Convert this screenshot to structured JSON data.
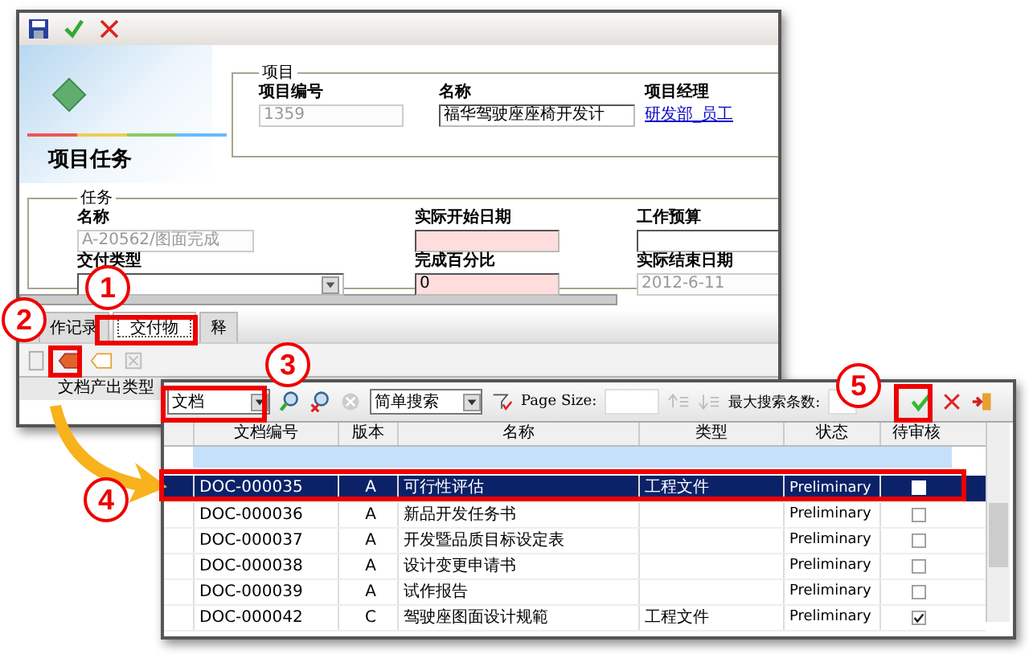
{
  "back_window": {
    "title": "项目任务",
    "project": {
      "legend": "项目",
      "fields": [
        {
          "label": "项目编号",
          "kind": "text",
          "value": "1359",
          "disabled": true
        },
        {
          "label": "名称",
          "kind": "text",
          "value": "福华驾驶座座椅开发计",
          "disabled": false
        },
        {
          "label": "项目经理",
          "kind": "link",
          "value": "研发部_员工"
        }
      ]
    },
    "task": {
      "legend": "任务",
      "fields": [
        {
          "label": "名称",
          "kind": "text",
          "value": "A-20562/图面完成",
          "disabled": true,
          "required": false
        },
        {
          "label": "实际开始日期",
          "kind": "text",
          "disabled": false,
          "required": true
        },
        {
          "label": "工作预算",
          "kind": "text",
          "disabled": false,
          "required": false
        },
        {
          "label": "交付类型",
          "kind": "select",
          "disabled": false,
          "required": false
        },
        {
          "label": "完成百分比",
          "kind": "text",
          "value": "0",
          "disabled": false,
          "required": true
        },
        {
          "label": "实际结束日期",
          "kind": "text",
          "value": "2012-6-11",
          "disabled": true,
          "required": false
        }
      ]
    },
    "tabs": [
      {
        "label": "作记录",
        "selected": false
      },
      {
        "label": "交付物",
        "selected": true
      },
      {
        "label": "释",
        "selected": false
      }
    ],
    "grid_header": "文档产出类型"
  },
  "front_window": {
    "doc_type": "文档",
    "search_mode": "简单搜索",
    "page_size_label": "Page Size:",
    "max_results_label": "最大搜索条数:",
    "table": {
      "columns": [
        "文档编号",
        "版本",
        "名称",
        "类型",
        "状态",
        "待审核"
      ],
      "rows": [
        {
          "cells": [
            "DOC-000035",
            "A",
            "可行性评估",
            "工程文件",
            "Preliminary"
          ],
          "pending": false,
          "selected": true
        },
        {
          "cells": [
            "DOC-000036",
            "A",
            "新品开发任务书",
            "",
            "Preliminary"
          ],
          "pending": false,
          "selected": false
        },
        {
          "cells": [
            "DOC-000037",
            "A",
            "开发暨品质目标设定表",
            "",
            "Preliminary"
          ],
          "pending": false,
          "selected": false
        },
        {
          "cells": [
            "DOC-000038",
            "A",
            "设计变更申请书",
            "",
            "Preliminary"
          ],
          "pending": false,
          "selected": false
        },
        {
          "cells": [
            "DOC-000039",
            "A",
            "试作报告",
            "",
            "Preliminary"
          ],
          "pending": false,
          "selected": false
        },
        {
          "cells": [
            "DOC-000042",
            "C",
            "驾驶座图面设计规範",
            "工程文件",
            "Preliminary"
          ],
          "pending": true,
          "selected": false
        }
      ]
    }
  },
  "callouts": [
    {
      "label": "1"
    },
    {
      "label": "2"
    },
    {
      "label": "3"
    },
    {
      "label": "4"
    },
    {
      "label": "5"
    }
  ]
}
